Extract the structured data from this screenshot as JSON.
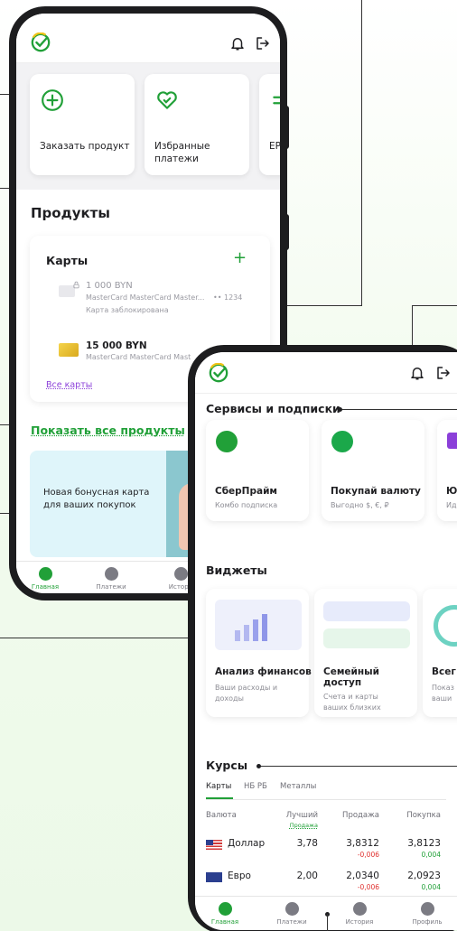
{
  "colors": {
    "brand_green": "#21a038",
    "link_purple": "#8b3fd9",
    "negative": "#e0312f"
  },
  "phone_left": {
    "topbar": {
      "logo": "sber-logo-icon",
      "icons": [
        "bell-icon",
        "logout-icon"
      ]
    },
    "quick_actions": [
      {
        "label": "Заказать продукт",
        "icon": "plus-circle-icon"
      },
      {
        "label": "Избранные платежи",
        "icon": "heart-check-icon"
      },
      {
        "label": "ЕР",
        "icon": "transfer-icon"
      }
    ],
    "products": {
      "title": "Продукты",
      "cards_title": "Карты",
      "add": "+",
      "items": [
        {
          "amount": "1 000 BYN",
          "name": "MasterCard MasterCard Master...",
          "masked": "•• 1234",
          "status": "Карта заблокирована"
        },
        {
          "amount": "15 000 BYN",
          "name": "MasterCard MasterCard Mast"
        }
      ],
      "all_cards": "Все карты"
    },
    "show_all": "Показать все продукты",
    "promo": "Новая бонусная карта для ваших покупок",
    "tabs": [
      "Главная",
      "Платежи",
      "Истори"
    ]
  },
  "phone_right": {
    "topbar": {
      "logo": "sber-logo-icon",
      "icons": [
        "bell-icon",
        "logout-icon"
      ]
    },
    "services": {
      "title": "Сервисы и подписки",
      "items": [
        {
          "title": "СберПрайм",
          "subtitle": "Комбо подписка"
        },
        {
          "title": "Покупай валюту",
          "subtitle": "Выгодно $, €, ₽"
        },
        {
          "title": "Ю",
          "subtitle": "Ид"
        }
      ]
    },
    "widgets": {
      "title": "Виджеты",
      "items": [
        {
          "title": "Анализ финансов",
          "subtitle": "Ваши расходы и доходы"
        },
        {
          "title": "Семейный доступ",
          "subtitle": "Счета и карты ваших близких"
        },
        {
          "title": "Всег",
          "subtitle": "Показ ваши"
        }
      ]
    },
    "rates": {
      "title": "Курсы",
      "tabs": [
        "Карты",
        "НБ РБ",
        "Металлы"
      ],
      "headers": {
        "currency": "Валюта",
        "best": "Лучший",
        "best_sub": "Продажа",
        "sell": "Продажа",
        "buy": "Покупка"
      },
      "rows": [
        {
          "flag": "us-flag-icon",
          "name": "Доллар",
          "best": "3,78",
          "sell": "3,8312",
          "sell_delta": "-0,006",
          "buy": "3,8123",
          "buy_delta": "0,004"
        },
        {
          "flag": "eu-flag-icon",
          "name": "Евро",
          "best": "2,00",
          "sell": "2,0340",
          "sell_delta": "-0,006",
          "buy": "2,0923",
          "buy_delta": "0,004"
        }
      ]
    },
    "tabs": [
      "Главная",
      "Платежи",
      "История",
      "Профиль"
    ]
  }
}
